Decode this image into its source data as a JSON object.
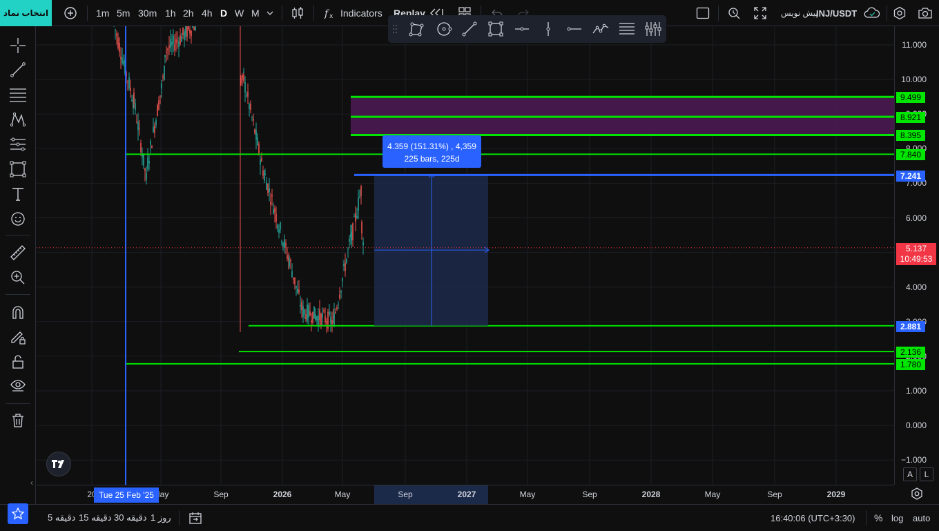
{
  "toolbar": {
    "symbol_search_label": "انتخاب نماد",
    "timeframes": [
      "1m",
      "5m",
      "30m",
      "1h",
      "2h",
      "4h",
      "D",
      "W",
      "M"
    ],
    "active_timeframe": "D",
    "indicators_label": "Indicators",
    "replay_label": "Replay",
    "symbol": "INJ/USDT",
    "preview_label": "پیش نویس"
  },
  "price_axis": {
    "ticks": [
      "11.000",
      "10.000",
      "9.000",
      "8.000",
      "7.000",
      "6.000",
      "5.000",
      "4.000",
      "3.000",
      "2.000",
      "1.000",
      "0.000",
      "−1.000"
    ],
    "labels": [
      {
        "text": "9.499",
        "color": "#00e600"
      },
      {
        "text": "8.921",
        "color": "#00e600"
      },
      {
        "text": "8.395",
        "color": "#00e600"
      },
      {
        "text": "7.840",
        "color": "#00e600"
      },
      {
        "text": "7.241",
        "color": "#2962ff"
      },
      {
        "text": "2.881",
        "color": "#2962ff"
      },
      {
        "text": "2.136",
        "color": "#00e600"
      },
      {
        "text": "1.780",
        "color": "#00e600"
      }
    ],
    "last_price": "5.137",
    "countdown": "10:49:53",
    "last_price_color": "#f23645"
  },
  "time_axis": {
    "ticks": [
      "20",
      "May",
      "Sep",
      "2026",
      "May",
      "Sep",
      "2027",
      "May",
      "Sep",
      "2028",
      "May",
      "Sep",
      "2029"
    ],
    "crosshair_date": "Tue 25 Feb '25"
  },
  "measure": {
    "line1": "4.359 (151.31%) , 4,359",
    "line2": "225 bars, 225d"
  },
  "scale_buttons": {
    "a": "A",
    "l": "L"
  },
  "bottom": {
    "ranges": [
      "5 دقیقه",
      "15 دقیقه",
      "30 دقیقه",
      "1 روز"
    ],
    "clock": "16:40:06 (UTC+3:30)",
    "percent": "%",
    "log": "log",
    "auto": "auto"
  },
  "colors": {
    "accent": "#22d3c5",
    "green_line": "#00e600",
    "blue_line": "#2962ff",
    "zone_fill": "#4a1a52"
  }
}
